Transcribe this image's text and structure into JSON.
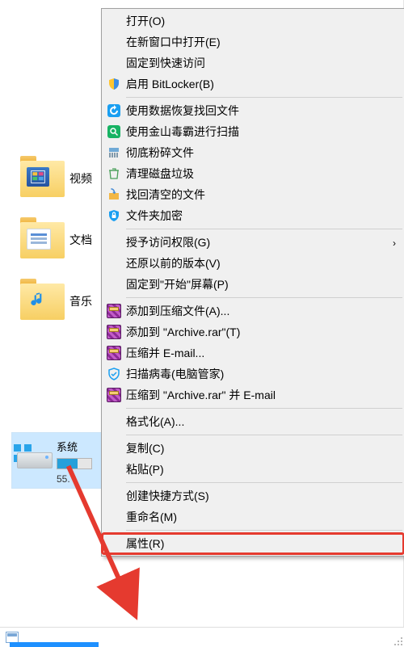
{
  "explorer": {
    "folders": [
      {
        "label": "视频",
        "kind": "video"
      },
      {
        "label": "文档",
        "kind": "doc"
      },
      {
        "label": "音乐",
        "kind": "music"
      }
    ],
    "drive": {
      "name": "系统",
      "used_pct": 60,
      "sub": "55."
    }
  },
  "menu": {
    "groups": [
      [
        {
          "label": "打开(O)",
          "icon": ""
        },
        {
          "label": "在新窗口中打开(E)",
          "icon": ""
        },
        {
          "label": "固定到快速访问",
          "icon": ""
        },
        {
          "label": "启用 BitLocker(B)",
          "icon": "shield-uac"
        }
      ],
      [
        {
          "label": "使用数据恢复找回文件",
          "icon": "recover-blue"
        },
        {
          "label": "使用金山毒霸进行扫描",
          "icon": "scan-green"
        },
        {
          "label": "彻底粉碎文件",
          "icon": "shred"
        },
        {
          "label": "清理磁盘垃圾",
          "icon": "trash"
        },
        {
          "label": "找回清空的文件",
          "icon": "undelete"
        },
        {
          "label": "文件夹加密",
          "icon": "lock-blue"
        }
      ],
      [
        {
          "label": "授予访问权限(G)",
          "icon": "",
          "arrow": true
        },
        {
          "label": "还原以前的版本(V)",
          "icon": ""
        },
        {
          "label": "固定到\"开始\"屏幕(P)",
          "icon": ""
        }
      ],
      [
        {
          "label": "添加到压缩文件(A)...",
          "icon": "rar"
        },
        {
          "label": "添加到 \"Archive.rar\"(T)",
          "icon": "rar"
        },
        {
          "label": "压缩并 E-mail...",
          "icon": "rar"
        },
        {
          "label": "扫描病毒(电脑管家)",
          "icon": "shield-blue"
        },
        {
          "label": "压缩到 \"Archive.rar\" 并 E-mail",
          "icon": "rar"
        }
      ],
      [
        {
          "label": "格式化(A)...",
          "icon": ""
        }
      ],
      [
        {
          "label": "复制(C)",
          "icon": ""
        },
        {
          "label": "粘贴(P)",
          "icon": ""
        }
      ],
      [
        {
          "label": "创建快捷方式(S)",
          "icon": ""
        },
        {
          "label": "重命名(M)",
          "icon": ""
        }
      ],
      [
        {
          "label": "属性(R)",
          "icon": ""
        }
      ]
    ]
  }
}
